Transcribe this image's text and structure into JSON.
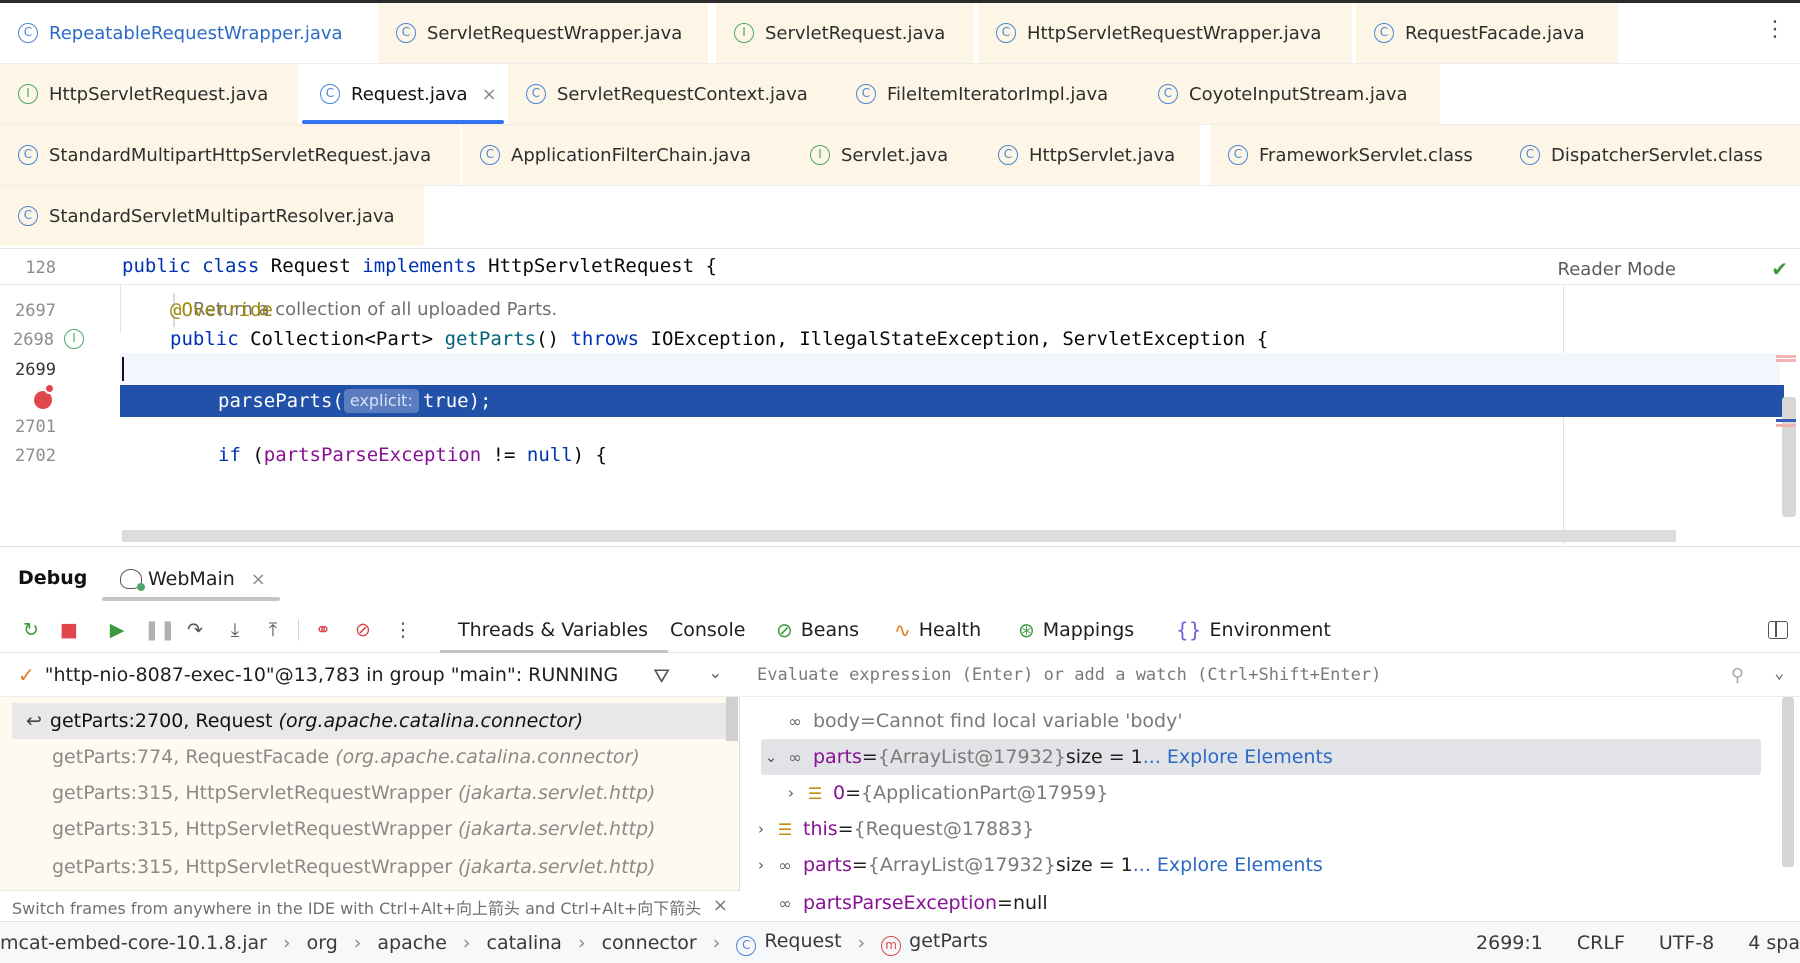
{
  "tabs": {
    "row1": [
      {
        "label": "RepeatableRequestWrapper.java",
        "icon": "C"
      },
      {
        "label": "ServletRequestWrapper.java",
        "icon": "C"
      },
      {
        "label": "ServletRequest.java",
        "icon": "I"
      },
      {
        "label": "HttpServletRequestWrapper.java",
        "icon": "C"
      },
      {
        "label": "RequestFacade.java",
        "icon": "C"
      }
    ],
    "row2": [
      {
        "label": "HttpServletRequest.java",
        "icon": "I"
      },
      {
        "label": "Request.java",
        "icon": "C"
      },
      {
        "label": "ServletRequestContext.java",
        "icon": "C"
      },
      {
        "label": "FileItemIteratorImpl.java",
        "icon": "C"
      },
      {
        "label": "CoyoteInputStream.java",
        "icon": "C"
      }
    ],
    "row3": [
      {
        "label": "StandardMultipartHttpServletRequest.java",
        "icon": "C"
      },
      {
        "label": "ApplicationFilterChain.java",
        "icon": "C"
      },
      {
        "label": "Servlet.java",
        "icon": "I"
      },
      {
        "label": "HttpServlet.java",
        "icon": "C"
      },
      {
        "label": "FrameworkServlet.class",
        "icon": "C"
      },
      {
        "label": "DispatcherServlet.class",
        "icon": "C"
      }
    ],
    "row4": [
      {
        "label": "StandardServletMultipartResolver.java",
        "icon": "C"
      }
    ],
    "close_glyph": "×",
    "more_glyph": "⋮"
  },
  "editor": {
    "sticky_line_number": "128",
    "sticky": {
      "kw1": "public",
      "kw2": "class",
      "name": "Request",
      "kw3": "implements",
      "iface": "HttpServletRequest",
      "brace": "{"
    },
    "reader_mode": "Reader Mode",
    "doc_comment": "Return a collection of all uploaded Parts.",
    "lines": {
      "l2697": "2697",
      "l2698": "2698",
      "l2699": "2699",
      "l2701": "2701",
      "l2702": "2702"
    },
    "code_2697": "@Override",
    "code_2698": {
      "kw": "public",
      "type": "Collection<Part>",
      "method": "getParts",
      "params": "()",
      "kw2": "throws",
      "rest": "IOException, IllegalStateException, ServletException {"
    },
    "code_2700": {
      "method": "parseParts(",
      "hint": "explicit:",
      "arg": "true);"
    },
    "code_2702": {
      "kw": "if",
      "open": "(",
      "field": "partsParseException",
      "op": " != ",
      "null": "null",
      "close": ") {"
    }
  },
  "debug": {
    "title": "Debug",
    "run_config": "WebMain",
    "tabs": [
      {
        "label": "Threads & Variables",
        "icon": ""
      },
      {
        "label": "Console",
        "icon": ""
      },
      {
        "label": "Beans",
        "icon": "⊘"
      },
      {
        "label": "Health",
        "icon": "∿"
      },
      {
        "label": "Mappings",
        "icon": "⊛"
      },
      {
        "label": "Environment",
        "icon": "{}"
      }
    ],
    "thread": "\"http-nio-8087-exec-10\"@13,783 in group \"main\": RUNNING",
    "frames": [
      {
        "method": "getParts:2700, Request",
        "pkg": "(org.apache.catalina.connector)"
      },
      {
        "method": "getParts:774, RequestFacade",
        "pkg": "(org.apache.catalina.connector)"
      },
      {
        "method": "getParts:315, HttpServletRequestWrapper",
        "pkg": "(jakarta.servlet.http)"
      },
      {
        "method": "getParts:315, HttpServletRequestWrapper",
        "pkg": "(jakarta.servlet.http)"
      },
      {
        "method": "getParts:315, HttpServletRequestWrapper",
        "pkg": "(jakarta.servlet.http)"
      }
    ],
    "switch_hint": "Switch frames from anywhere in the IDE with Ctrl+Alt+向上箭头 and Ctrl+Alt+向下箭头",
    "eval_placeholder": "Evaluate expression (Enter) or add a watch (Ctrl+Shift+Enter)",
    "variables": [
      {
        "name": "body",
        "eq": " = ",
        "value": "Cannot find local variable 'body'",
        "extra": "",
        "link": ""
      },
      {
        "name": "parts",
        "eq": " = ",
        "value": "{ArrayList@17932}",
        "extra": "  size = 1",
        "link": "... Explore Elements"
      },
      {
        "name": "0",
        "eq": " = ",
        "value": "{ApplicationPart@17959}",
        "extra": "",
        "link": ""
      },
      {
        "name": "this",
        "eq": " = ",
        "value": "{Request@17883}",
        "extra": "",
        "link": ""
      },
      {
        "name": "parts",
        "eq": " = ",
        "value": "{ArrayList@17932}",
        "extra": "  size = 1",
        "link": "... Explore Elements"
      },
      {
        "name": "partsParseException",
        "eq": " = ",
        "value": "null",
        "extra": "",
        "link": ""
      }
    ]
  },
  "statusbar": {
    "crumbs": [
      "mcat-embed-core-10.1.8.jar",
      "org",
      "apache",
      "catalina",
      "connector",
      "Request",
      "getParts"
    ],
    "position": "2699:1",
    "line_ending": "CRLF",
    "encoding": "UTF-8",
    "indent": "4 spa"
  },
  "colors": {
    "accent": "#3574f0",
    "exec_line": "#2151a8",
    "breakpoint": "#e0474c",
    "modified_tab": "#fdf6e6",
    "frames_bg": "#fffaf0"
  }
}
